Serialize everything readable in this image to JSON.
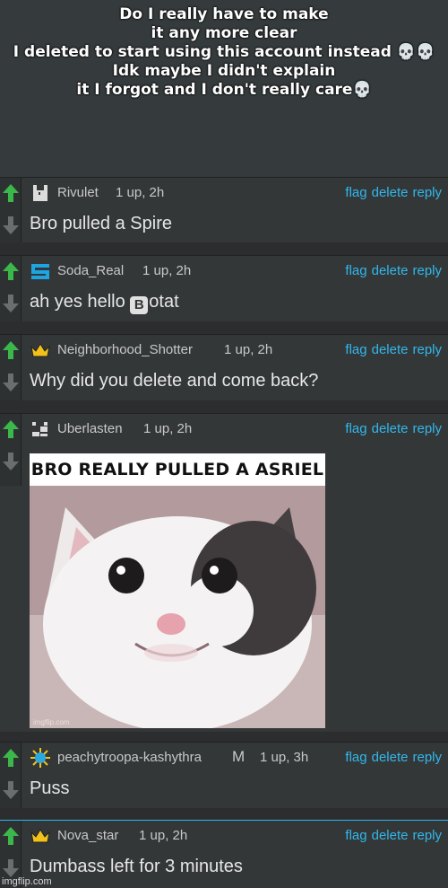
{
  "caption": {
    "lines": [
      "Do I really have to make",
      "it any more clear",
      "I deleted to start using this account instead 💀💀",
      "Idk maybe I didn't explain",
      "it I forgot and I don't really care💀"
    ]
  },
  "actions": {
    "flag": "flag",
    "delete": "delete",
    "reply": "reply"
  },
  "comments": [
    {
      "username": "Rivulet",
      "meta": "1 up, 2h",
      "text": "Bro pulled a Spire",
      "avatar": "pixel-creature-icon"
    },
    {
      "username": "Soda_Real",
      "meta": "1 up, 2h",
      "text_prefix": "ah yes hello ",
      "emoji": "B",
      "text_suffix": "otat",
      "avatar": "blue-logo-icon"
    },
    {
      "username": "Neighborhood_Shotter",
      "meta": "1 up, 2h",
      "text": "Why did you delete and come back?",
      "avatar": "crown-icon"
    },
    {
      "username": "Uberlasten",
      "meta": "1 up, 2h",
      "avatar": "pixel-face-icon",
      "meme_caption": "BRO REALLY PULLED A ASRIEL",
      "meme_watermark": "imgflip.com"
    },
    {
      "username": "peachytroopa-kashythra",
      "badge": "M",
      "meta": "1 up, 3h",
      "text": "Puss",
      "avatar": "sun-icon"
    },
    {
      "username": "Nova_star",
      "meta": "1 up, 2h",
      "text": "Dumbass left for 3 minutes",
      "avatar": "crown-icon"
    }
  ],
  "watermark": "imgflip.com",
  "colors": {
    "link": "#30b8ec",
    "upvote": "#3cb84a",
    "panel": "#343738"
  }
}
